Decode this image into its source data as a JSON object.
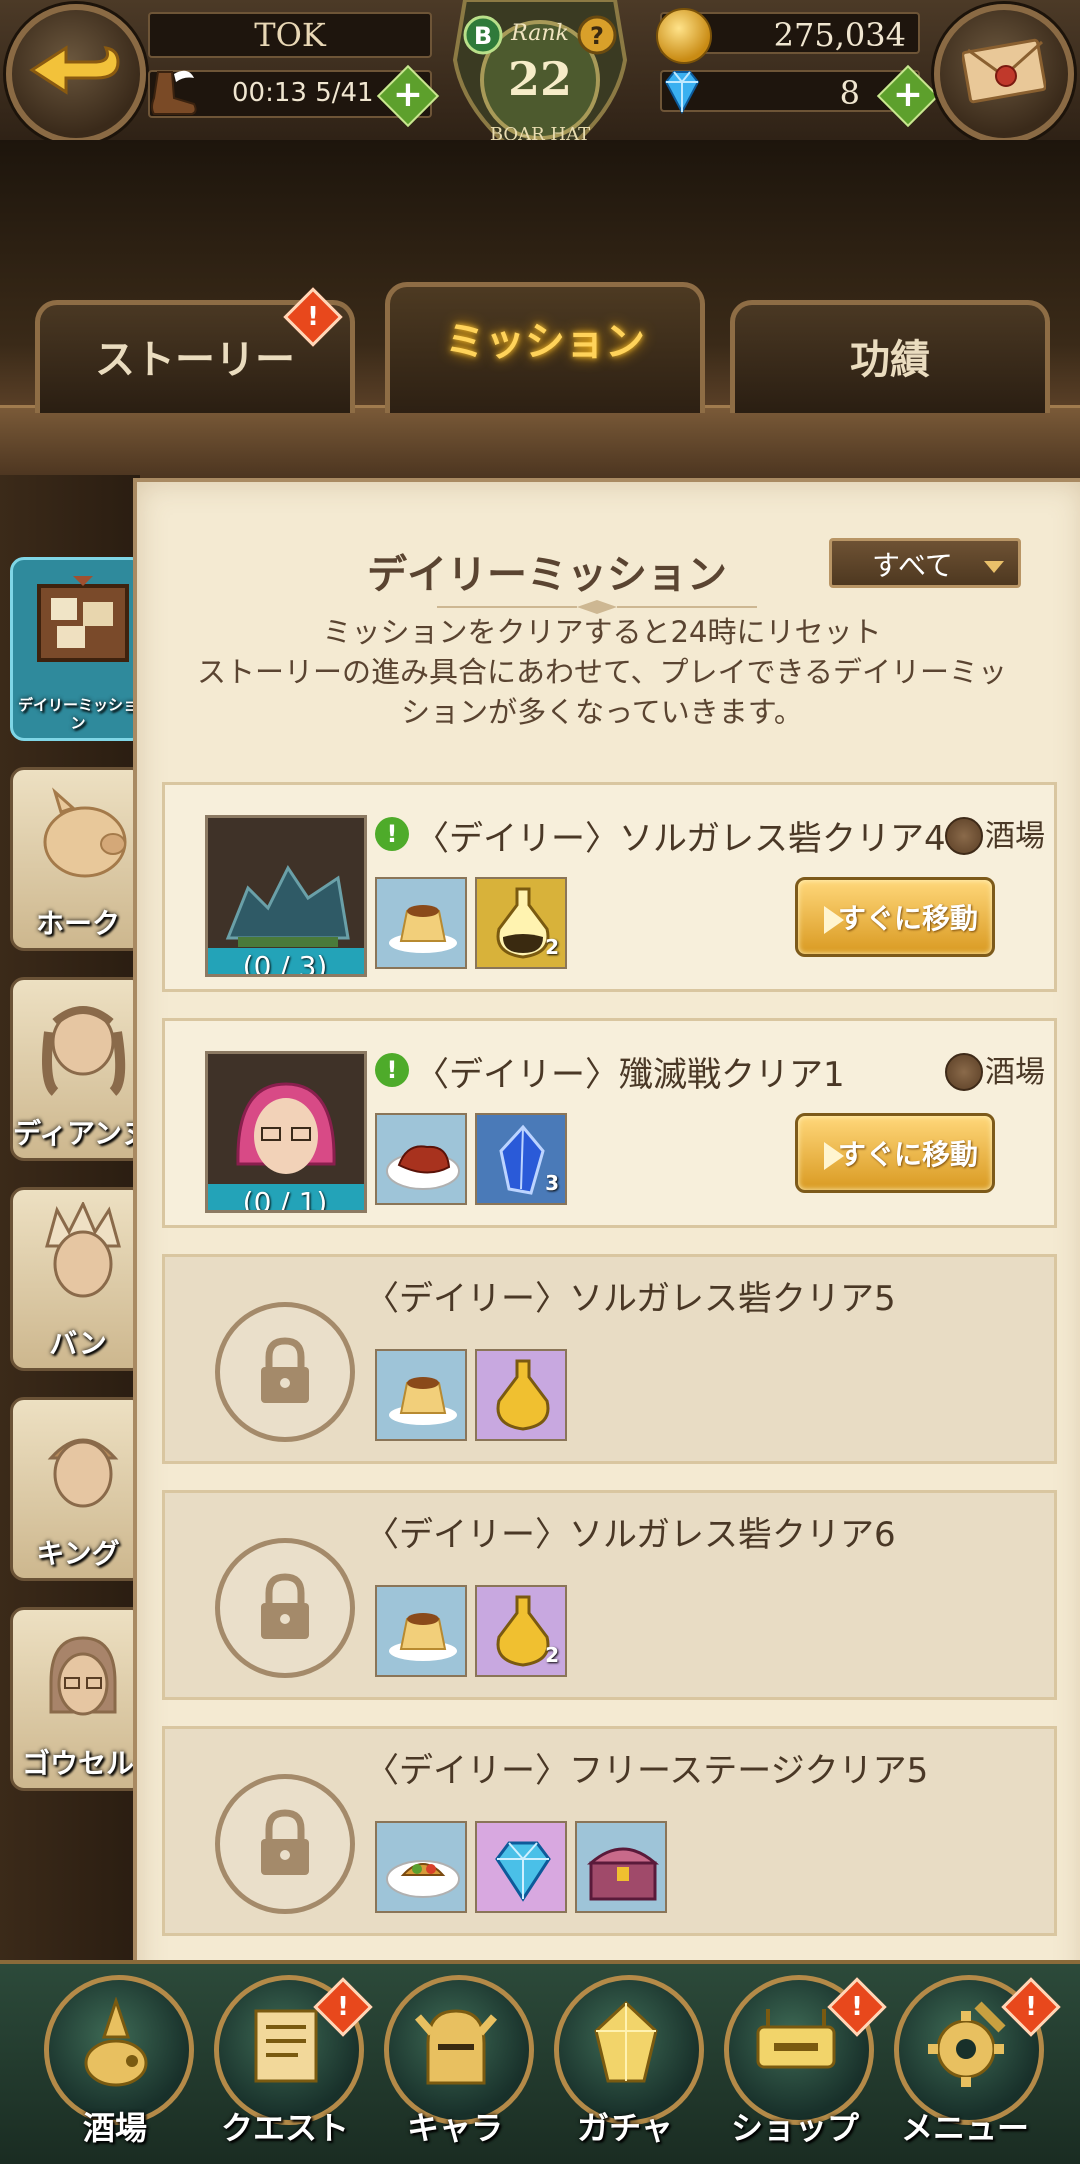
{
  "header": {
    "player_name": "TOK",
    "stamina_timer": "00:13",
    "stamina_value": "5/41",
    "rank_label": "Rank",
    "rank_value": "22",
    "rank_title": "BOAR HAT",
    "rank_letter": "B",
    "help_label": "?",
    "gold": "275,034",
    "gems": "8",
    "plus_label": "+"
  },
  "tabs": [
    {
      "label": "ストーリー",
      "alert": true
    },
    {
      "label": "ミッション",
      "active": true
    },
    {
      "label": "功績"
    }
  ],
  "alert_glyph": "!",
  "sidebar": {
    "items": [
      {
        "label": "デイリーミッション",
        "active": true
      },
      {
        "label": "ホーク"
      },
      {
        "label": "ディアンヌ"
      },
      {
        "label": "バン"
      },
      {
        "label": "キング"
      },
      {
        "label": "ゴウセル"
      }
    ]
  },
  "panel": {
    "title": "デイリーミッション",
    "filter_value": "すべて",
    "desc_line1": "ミッションをクリアすると24時にリセット",
    "desc_line2": "ストーリーの進み具合にあわせて、プレイできるデイリーミッ",
    "desc_line3": "ションが多くなっていきます。"
  },
  "missions": [
    {
      "title": "〈デイリー〉ソルガレス砦クリア4",
      "location": "酒場",
      "progress": "(0 / 3)",
      "button": "すぐに移動",
      "rewards": [
        "pudding",
        "elixir"
      ],
      "reward_counts": [
        "",
        "2"
      ],
      "locked": false
    },
    {
      "title": "〈デイリー〉殲滅戦クリア1",
      "location": "酒場",
      "progress": "(0 / 1)",
      "button": "すぐに移動",
      "rewards": [
        "meat",
        "crystal"
      ],
      "reward_counts": [
        "",
        "3"
      ],
      "locked": false
    },
    {
      "title": "〈デイリー〉ソルガレス砦クリア5",
      "rewards": [
        "pudding",
        "elixir"
      ],
      "reward_counts": [
        "",
        ""
      ],
      "locked": true
    },
    {
      "title": "〈デイリー〉ソルガレス砦クリア6",
      "rewards": [
        "pudding",
        "elixir"
      ],
      "reward_counts": [
        "",
        "2"
      ],
      "locked": true
    },
    {
      "title": "〈デイリー〉フリーステージクリア5",
      "rewards": [
        "salad",
        "gem",
        "chest"
      ],
      "reward_counts": [
        "",
        "",
        ""
      ],
      "locked": true
    }
  ],
  "bottom_nav": [
    {
      "label": "酒場",
      "icon": "tavern-icon"
    },
    {
      "label": "クエスト",
      "icon": "scroll-icon",
      "alert": true
    },
    {
      "label": "キャラ",
      "icon": "helmet-icon"
    },
    {
      "label": "ガチャ",
      "icon": "crystal-icon"
    },
    {
      "label": "ショップ",
      "icon": "shop-icon",
      "alert": true
    },
    {
      "label": "メニュー",
      "icon": "gear-icon",
      "alert": true
    }
  ]
}
